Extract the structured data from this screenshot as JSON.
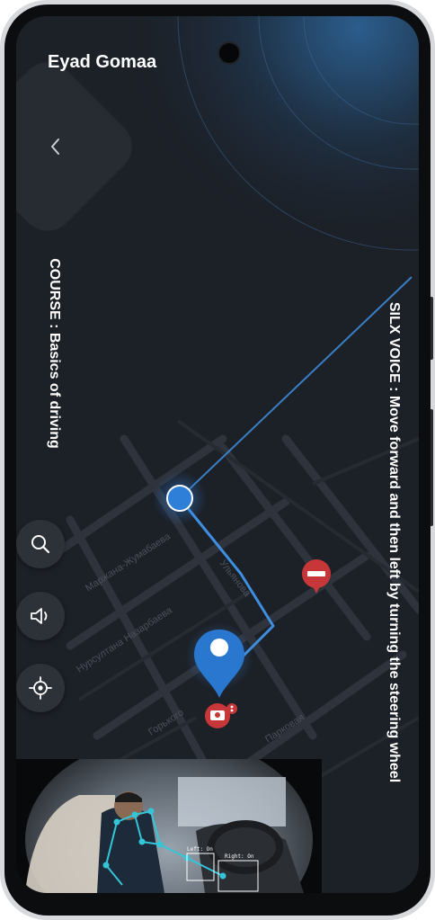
{
  "app": {
    "user_name": "Eyad Gomaa",
    "course_text": "COURSE : Basics of driving",
    "voice_text": "SILX VOICE : Move forward and then left by turning the steering wheel"
  },
  "map": {
    "streets": [
      "Маржана-Жумабаева",
      "Нурсултана Назарбаева",
      "Ульянова",
      "Горького",
      "Парковая"
    ],
    "route_color": "#3f8fe0",
    "background_color": "#1d2128"
  },
  "controls": [
    {
      "name": "search-button",
      "icon": "search-icon"
    },
    {
      "name": "sound-button",
      "icon": "speaker-icon"
    },
    {
      "name": "locate-button",
      "icon": "locate-icon"
    }
  ],
  "camera_feed": {
    "detections": [
      "Left: On",
      "Right: On"
    ]
  },
  "colors": {
    "accent": "#3f8fe0",
    "marker_red": "#c7373a",
    "text": "#ffffff"
  }
}
